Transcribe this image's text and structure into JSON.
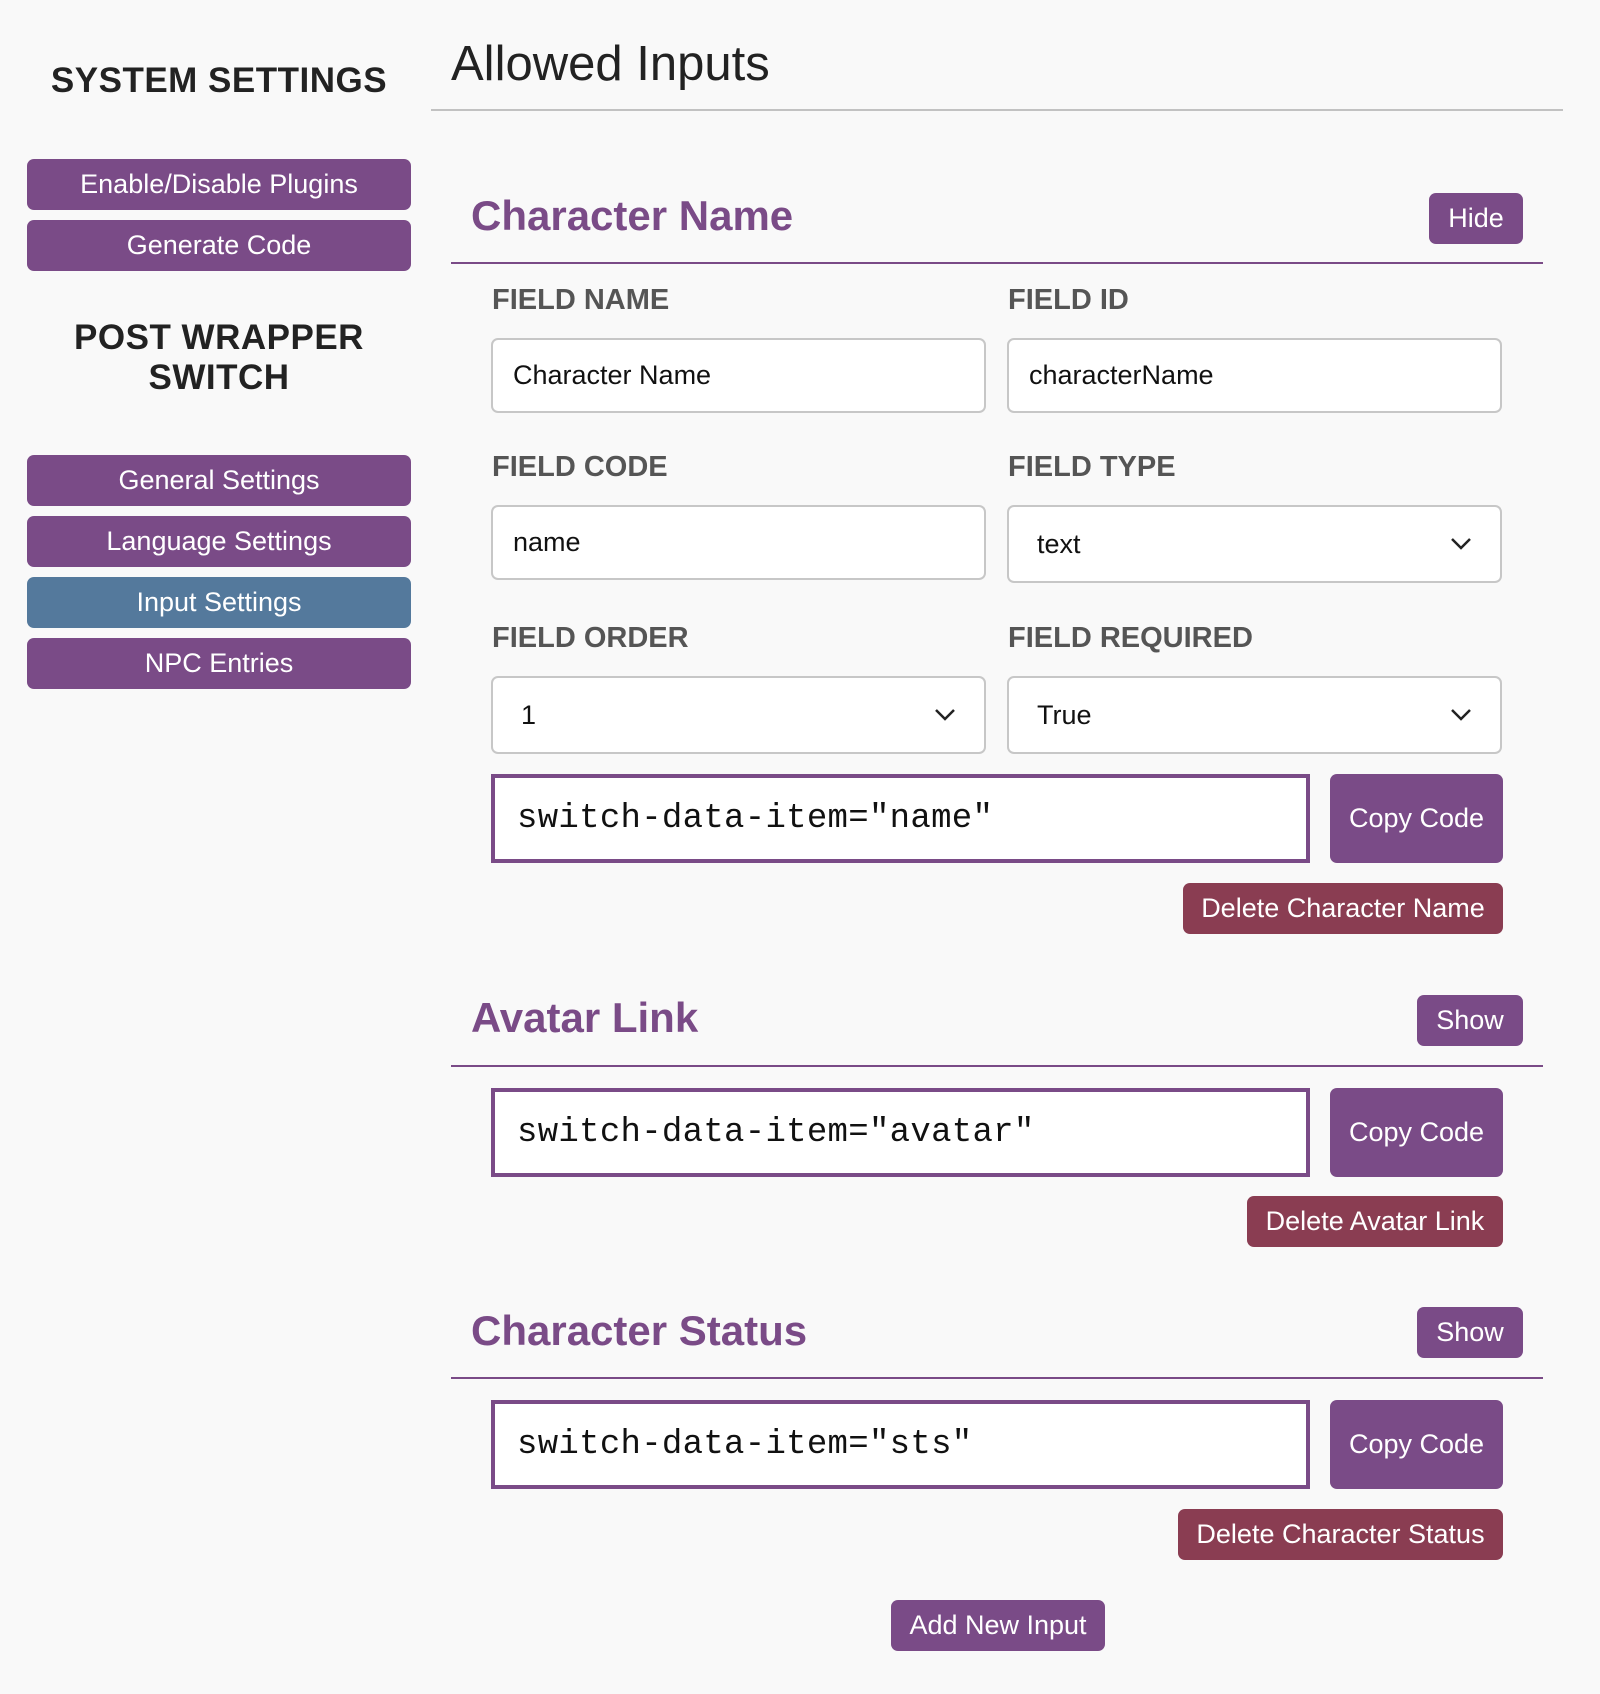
{
  "sidebar": {
    "system_heading": "SYSTEM SETTINGS",
    "system_items": [
      "Enable/Disable Plugins",
      "Generate Code"
    ],
    "post_wrapper_heading_line1": "POST WRAPPER",
    "post_wrapper_heading_line2": "SWITCH",
    "post_wrapper_items": [
      "General Settings",
      "Language Settings",
      "Input Settings",
      "NPC Entries"
    ],
    "active_item": "Input Settings"
  },
  "main": {
    "title": "Allowed Inputs",
    "sections": [
      {
        "title": "Character Name",
        "toggle_label": "Hide",
        "expanded": true,
        "fields": {
          "field_name_label": "FIELD NAME",
          "field_name_value": "Character Name",
          "field_id_label": "FIELD ID",
          "field_id_value": "characterName",
          "field_code_label": "FIELD CODE",
          "field_code_value": "name",
          "field_type_label": "FIELD TYPE",
          "field_type_value": "text",
          "field_order_label": "FIELD ORDER",
          "field_order_value": "1",
          "field_required_label": "FIELD REQUIRED",
          "field_required_value": "True"
        },
        "code": "switch-data-item=\"name\"",
        "copy_label": "Copy Code",
        "delete_label": "Delete Character Name"
      },
      {
        "title": "Avatar Link",
        "toggle_label": "Show",
        "expanded": false,
        "code": "switch-data-item=\"avatar\"",
        "copy_label": "Copy Code",
        "delete_label": "Delete Avatar Link"
      },
      {
        "title": "Character Status",
        "toggle_label": "Show",
        "expanded": false,
        "code": "switch-data-item=\"sts\"",
        "copy_label": "Copy Code",
        "delete_label": "Delete Character Status"
      }
    ],
    "add_button_label": "Add New Input"
  },
  "colors": {
    "primary": "#7a4b87",
    "active": "#54799c",
    "danger": "#8a3d52",
    "background": "#f9f9f9"
  }
}
